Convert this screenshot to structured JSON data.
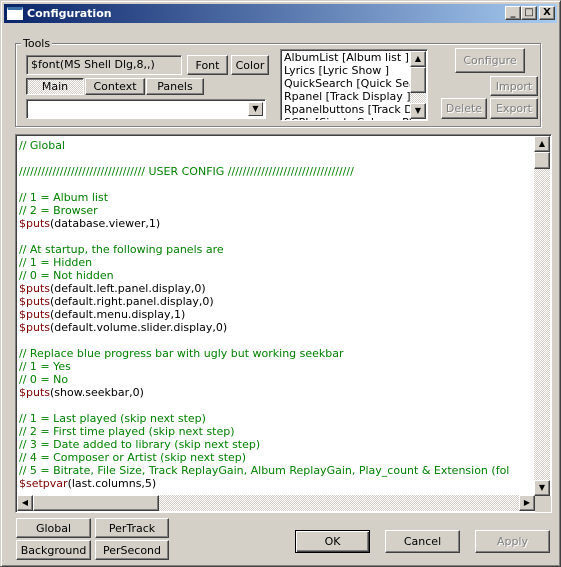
{
  "window": {
    "title": "Configuration",
    "controls": {
      "minimize": "_",
      "maximize": "□",
      "close": "X"
    }
  },
  "tools": {
    "label": "Tools",
    "font_value": "$font(MS Shell Dlg,8,,)",
    "font_button": "Font",
    "color_button": "Color",
    "tabs": [
      {
        "label": "Main",
        "selected": true
      },
      {
        "label": "Context",
        "selected": false
      },
      {
        "label": "Panels",
        "selected": false
      }
    ],
    "combo_value": "",
    "panel_list": [
      "AlbumList [Album list ]",
      "Lyrics [Lyric Show ]",
      "QuickSearch [Quick Search",
      "Rpanel [Track Display ]",
      "Rpanelbuttons [Track Displ",
      "SCPL [Single Column Playli"
    ],
    "configure_button": "Configure",
    "import_button": "Import",
    "delete_button": "Delete",
    "export_button": "Export"
  },
  "editor": {
    "lines": [
      [
        {
          "t": "// Global",
          "c": "comment"
        }
      ],
      [],
      [
        {
          "t": "////////////////////////////////// USER CONFIG //////////////////////////////////",
          "c": "comment"
        }
      ],
      [],
      [
        {
          "t": "// 1 = Album list",
          "c": "comment"
        }
      ],
      [
        {
          "t": "// 2 = Browser",
          "c": "comment"
        }
      ],
      [
        {
          "t": "$puts",
          "c": "func"
        },
        {
          "t": "(database.viewer,1)",
          "c": "text"
        }
      ],
      [],
      [
        {
          "t": "// At startup, the following panels are",
          "c": "comment"
        }
      ],
      [
        {
          "t": "// 1 = Hidden",
          "c": "comment"
        }
      ],
      [
        {
          "t": "// 0 = Not hidden",
          "c": "comment"
        }
      ],
      [
        {
          "t": "$puts",
          "c": "func"
        },
        {
          "t": "(default.left.panel.display,0)",
          "c": "text"
        }
      ],
      [
        {
          "t": "$puts",
          "c": "func"
        },
        {
          "t": "(default.right.panel.display,0)",
          "c": "text"
        }
      ],
      [
        {
          "t": "$puts",
          "c": "func"
        },
        {
          "t": "(default.menu.display,1)",
          "c": "text"
        }
      ],
      [
        {
          "t": "$puts",
          "c": "func"
        },
        {
          "t": "(default.volume.slider.display,0)",
          "c": "text"
        }
      ],
      [],
      [
        {
          "t": "// Replace blue progress bar with ugly but working seekbar",
          "c": "comment"
        }
      ],
      [
        {
          "t": "// 1 = Yes",
          "c": "comment"
        }
      ],
      [
        {
          "t": "// 0 = No",
          "c": "comment"
        }
      ],
      [
        {
          "t": "$puts",
          "c": "func"
        },
        {
          "t": "(show.seekbar,0)",
          "c": "text"
        }
      ],
      [],
      [
        {
          "t": "// 1 = Last played (skip next step)",
          "c": "comment"
        }
      ],
      [
        {
          "t": "// 2 = First time played (skip next step)",
          "c": "comment"
        }
      ],
      [
        {
          "t": "// 3 = Date added to library (skip next step)",
          "c": "comment"
        }
      ],
      [
        {
          "t": "// 4 = Composer or Artist (skip next step)",
          "c": "comment"
        }
      ],
      [
        {
          "t": "// 5 = Bitrate, File Size, Track ReplayGain, Album ReplayGain, Play_count & Extension (fol",
          "c": "comment"
        }
      ],
      [
        {
          "t": "$setpvar",
          "c": "func"
        },
        {
          "t": "(last.columns,5)",
          "c": "text"
        }
      ]
    ]
  },
  "bottom": {
    "global_button": "Global",
    "pertrack_button": "PerTrack",
    "background_button": "Background",
    "persecond_button": "PerSecond",
    "ok_button": "OK",
    "cancel_button": "Cancel",
    "apply_button": "Apply"
  },
  "icons": {
    "up": "▲",
    "down": "▼",
    "left": "◀",
    "right": "▶"
  }
}
